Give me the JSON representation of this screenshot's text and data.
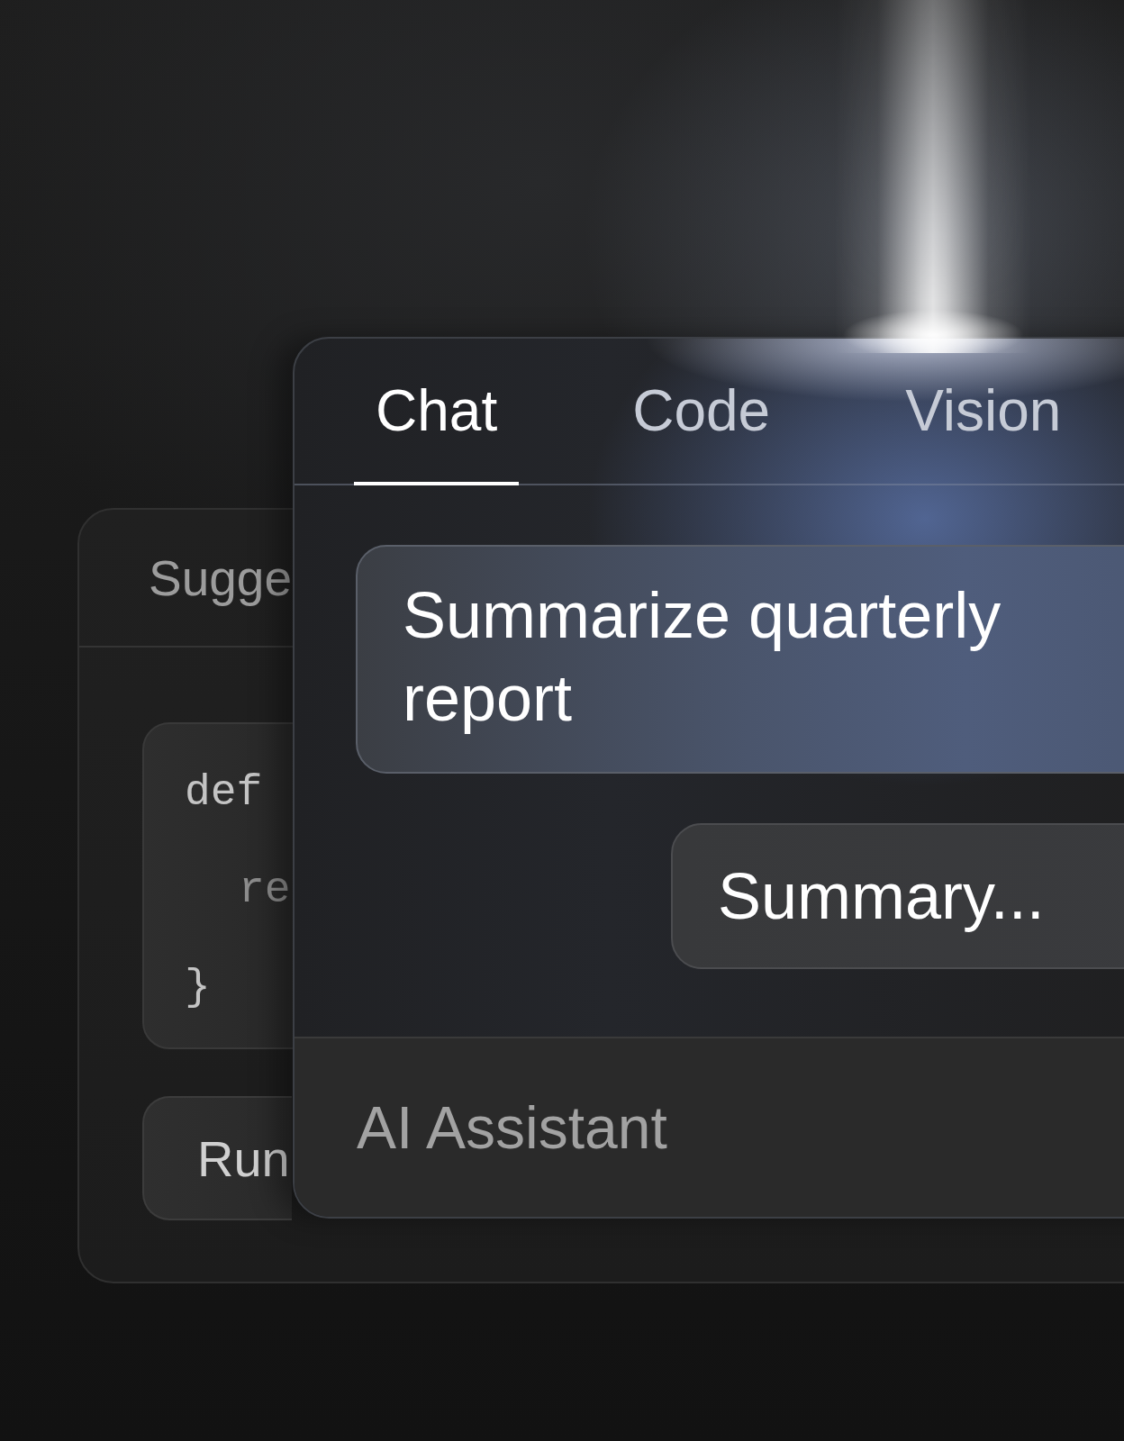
{
  "back_panel": {
    "title": "Sugge",
    "code": [
      {
        "text": "def",
        "children": [
          {
            "text": "re"
          }
        ]
      },
      {
        "text": "}"
      }
    ],
    "button": "Run"
  },
  "front_panel": {
    "tabs": [
      {
        "label": "Chat",
        "selected": true
      },
      {
        "label": "Code",
        "selected": false
      },
      {
        "label": "Vision",
        "selected": false
      }
    ],
    "messages": [
      {
        "kind": "prompt",
        "text": "Summarize quarterly report"
      },
      {
        "kind": "response",
        "text": "Summary..."
      }
    ],
    "footer": "AI Assistant"
  }
}
